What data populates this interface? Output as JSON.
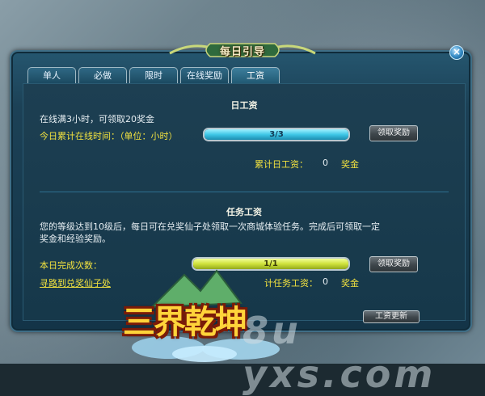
{
  "window": {
    "title": "每日引导",
    "close_glyph": "×"
  },
  "tabs": [
    {
      "label": "单人"
    },
    {
      "label": "必做"
    },
    {
      "label": "限时"
    },
    {
      "label": "在线奖励"
    },
    {
      "label": "工资"
    }
  ],
  "daily_wage": {
    "title": "日工资",
    "description": "在线满3小时，可领取20奖金",
    "progress_label": "今日累计在线时间：（单位：小时）",
    "progress_text": "3/3",
    "progress_value": 3,
    "progress_max": 3,
    "claim_button": "领取奖励",
    "total_label": "累计日工资：",
    "total_value": "0",
    "total_unit": "奖金"
  },
  "task_wage": {
    "title": "任务工资",
    "description_line1": "您的等级达到10级后，每日可在兑奖仙子处领取一次商城体验任务。完成后可领取一定",
    "description_line2": "奖金和经验奖励。",
    "progress_label": "本日完成次数：",
    "progress_text": "1/1",
    "progress_value": 1,
    "progress_max": 1,
    "claim_button": "领取奖励",
    "total_label": "计任务工资：",
    "total_value": "0",
    "total_unit": "奖金",
    "link_text": "寻路到兑奖仙子处"
  },
  "bottom_button": "工资更新",
  "logo_text": "三界乾坤",
  "watermark_text": "8u yxs.com",
  "colors": {
    "accent_yellow": "#f1e13f",
    "bar_cyan": "#3ec6e6",
    "bar_yellow": "#cfe23c",
    "panel_blue": "#1c4156"
  }
}
